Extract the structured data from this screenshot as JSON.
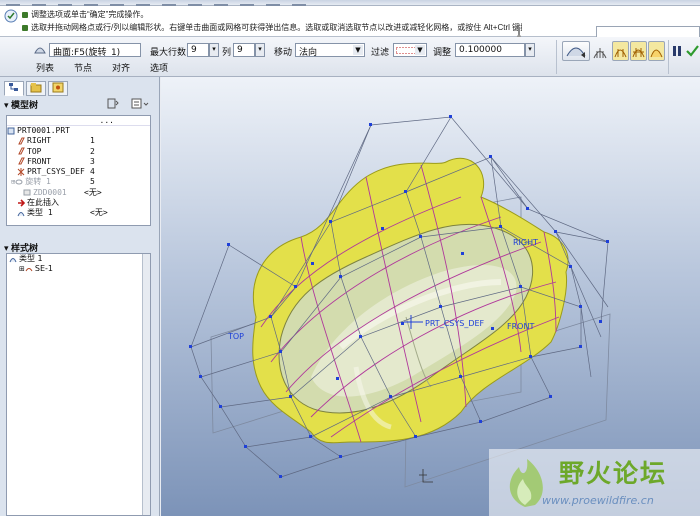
{
  "messages": {
    "line1": "调整选项或单击“确定”完成操作。",
    "line2": "选取并拖动网格点或行/列以编辑形状。右键单击曲面或网格可获得弹出信息。选取或取消选取节点以改进或减轻化网格，或按住 Alt+Ctrl 键按动鼠标以重新构建网格。",
    "line2_tail": "Alt+Ctrl 键按动鼠标以重新构建网格"
  },
  "dashboard": {
    "surface_value": "曲面:F5(旋转_1)",
    "max_rows_label": "最大行数",
    "max_rows_value": "9",
    "cols_label": "列",
    "cols_value": "9",
    "move_label": "移动",
    "move_value": "法向",
    "filter_label": "过滤",
    "adjust_label": "调整",
    "adjust_value": "0.100000",
    "tabs": [
      "列表",
      "节点",
      "对齐",
      "选项"
    ]
  },
  "model_tree": {
    "header": "模型树",
    "col_header": "...",
    "items": [
      {
        "label": "PRT0001.PRT",
        "value": "",
        "icon": "part-icon"
      },
      {
        "label": "RIGHT",
        "value": "1",
        "icon": "datum-plane-icon"
      },
      {
        "label": "TOP",
        "value": "2",
        "icon": "datum-plane-icon"
      },
      {
        "label": "FRONT",
        "value": "3",
        "icon": "datum-plane-icon"
      },
      {
        "label": "PRT_CSYS_DEF",
        "value": "4",
        "icon": "csys-icon"
      },
      {
        "label": "旋转 1",
        "value": "5",
        "icon": "revolve-icon"
      },
      {
        "label": "ZDD0001",
        "value": "<无>",
        "icon": "surface-icon"
      },
      {
        "label": "在此插入",
        "value": "",
        "icon": "insert-here-icon"
      },
      {
        "label": "类型 1",
        "value": "<无>",
        "icon": "style-icon"
      }
    ]
  },
  "style_tree": {
    "header": "样式树",
    "items": [
      {
        "label": "类型 1"
      },
      {
        "label": "SE-1"
      }
    ]
  },
  "viewport": {
    "labels": [
      "PRT_CSYS_DEF",
      "FRONT",
      "RIGHT",
      "TOP"
    ]
  },
  "watermark": {
    "title": "野火论坛",
    "url": "www.proewildfire.cn"
  },
  "colors": {
    "surface_fill": "#e3e04a",
    "mesh_line": "#b0389b",
    "control_net": "#55607a",
    "node": "#1f40d8",
    "watermark_green": "#6da82a"
  }
}
